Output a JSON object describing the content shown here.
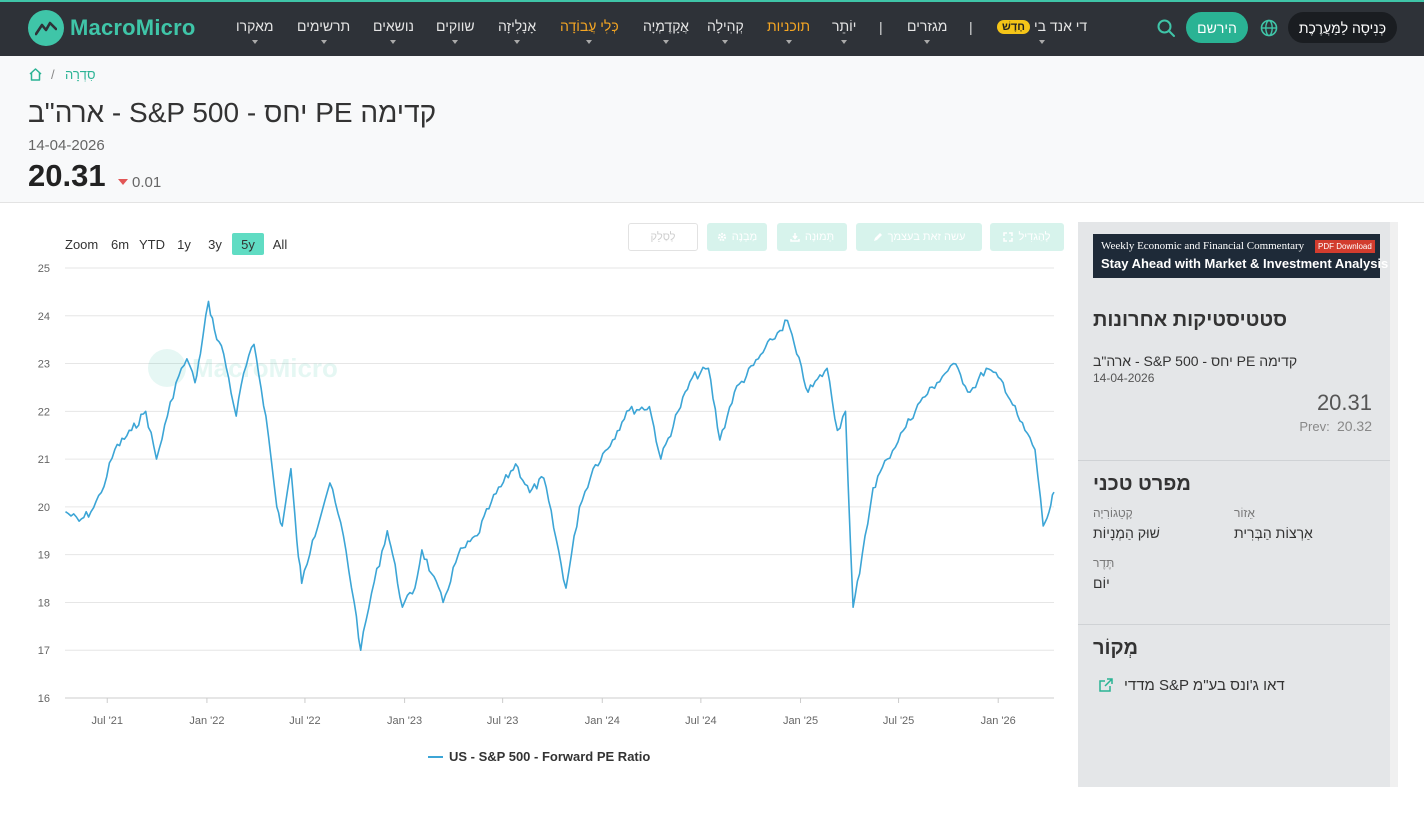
{
  "nav": {
    "logo_text": "MacroMicro",
    "items": [
      "מאקרו",
      "תרשימים",
      "נושאים",
      "שווקים",
      "אָנָלִיזָה",
      "כְּלִי עֲבוֹדָה",
      "אֲקָדֶמְיָה",
      "קְהִילָה",
      "תוכניות",
      "יוֹתֵר",
      "מגזרים",
      "די אנד בי"
    ],
    "separator": "|",
    "new_badge": "חָדָשׁ",
    "register": "הירשם",
    "login": "כְּנִיסָה לַמַּעֲרֶכֶת"
  },
  "breadcrumb": {
    "separator": "/",
    "link": "סִדְרָה"
  },
  "header": {
    "title": "ארה\"ב - S&P 500 - יחס PE קדימה",
    "date": "14-04-2026",
    "value": "20.31",
    "change": "0.01"
  },
  "toolbar": {
    "zoom_label": "Zoom",
    "ranges": [
      "6m",
      "YTD",
      "1y",
      "3y",
      "5y",
      "All"
    ],
    "active_range": "5y",
    "buttons": [
      "לְהַגדִיל",
      "עשה זאת בעצמך",
      "תְּמוּנָה",
      "מַבְנֶה",
      "לְסַלֵק"
    ]
  },
  "chart_data": {
    "type": "line",
    "title": "",
    "xlabel": "",
    "ylabel": "",
    "x_ticks": [
      "Jul '21",
      "Jan '22",
      "Jul '22",
      "Jan '23",
      "Jul '23",
      "Jan '24",
      "Jul '24",
      "Jan '25",
      "Jul '25",
      "Jan '26"
    ],
    "ylim": [
      16,
      25
    ],
    "y_ticks": [
      16,
      17,
      18,
      19,
      20,
      21,
      22,
      23,
      24,
      25
    ],
    "grid": true,
    "legend_position": "bottom-center",
    "watermark": "MacroMicro",
    "series": [
      {
        "name": "US - S&P 500 - Forward PE Ratio",
        "color": "#3ca5d6",
        "points": [
          [
            "2021-04-15",
            19.9
          ],
          [
            "2021-05-10",
            19.7
          ],
          [
            "2021-06-01",
            19.9
          ],
          [
            "2021-06-20",
            20.3
          ],
          [
            "2021-07-15",
            21.2
          ],
          [
            "2021-08-15",
            21.6
          ],
          [
            "2021-09-10",
            22.0
          ],
          [
            "2021-09-30",
            21.0
          ],
          [
            "2021-10-20",
            21.9
          ],
          [
            "2021-11-05",
            22.6
          ],
          [
            "2021-11-25",
            23.1
          ],
          [
            "2021-12-10",
            22.6
          ],
          [
            "2021-12-20",
            23.2
          ],
          [
            "2022-01-04",
            24.3
          ],
          [
            "2022-01-15",
            23.7
          ],
          [
            "2022-02-01",
            23.2
          ],
          [
            "2022-02-24",
            21.9
          ],
          [
            "2022-03-10",
            22.8
          ],
          [
            "2022-03-29",
            23.4
          ],
          [
            "2022-04-20",
            21.9
          ],
          [
            "2022-05-10",
            20.0
          ],
          [
            "2022-05-20",
            19.6
          ],
          [
            "2022-06-05",
            20.8
          ],
          [
            "2022-06-16",
            19.3
          ],
          [
            "2022-06-25",
            18.4
          ],
          [
            "2022-07-15",
            19.3
          ],
          [
            "2022-08-16",
            20.5
          ],
          [
            "2022-09-10",
            19.4
          ],
          [
            "2022-09-30",
            18.0
          ],
          [
            "2022-10-12",
            17.0
          ],
          [
            "2022-11-01",
            18.2
          ],
          [
            "2022-11-30",
            19.5
          ],
          [
            "2022-12-10",
            19.0
          ],
          [
            "2022-12-28",
            17.9
          ],
          [
            "2023-01-20",
            18.3
          ],
          [
            "2023-02-02",
            19.1
          ],
          [
            "2023-02-20",
            18.6
          ],
          [
            "2023-03-13",
            18.0
          ],
          [
            "2023-04-10",
            19.0
          ],
          [
            "2023-05-15",
            19.4
          ],
          [
            "2023-06-10",
            20.1
          ],
          [
            "2023-07-25",
            20.9
          ],
          [
            "2023-08-20",
            20.3
          ],
          [
            "2023-09-15",
            20.6
          ],
          [
            "2023-10-26",
            18.3
          ],
          [
            "2023-11-20",
            20.0
          ],
          [
            "2023-12-15",
            20.8
          ],
          [
            "2024-01-20",
            21.4
          ],
          [
            "2024-02-15",
            22.0
          ],
          [
            "2024-03-28",
            22.1
          ],
          [
            "2024-04-18",
            21.0
          ],
          [
            "2024-05-20",
            22.0
          ],
          [
            "2024-06-15",
            22.7
          ],
          [
            "2024-07-15",
            22.9
          ],
          [
            "2024-08-05",
            21.4
          ],
          [
            "2024-09-01",
            22.4
          ],
          [
            "2024-10-15",
            23.1
          ],
          [
            "2024-11-10",
            23.5
          ],
          [
            "2024-12-08",
            23.9
          ],
          [
            "2024-12-25",
            23.2
          ],
          [
            "2025-01-15",
            22.4
          ],
          [
            "2025-02-19",
            22.9
          ],
          [
            "2025-03-10",
            21.6
          ],
          [
            "2025-03-25",
            22.0
          ],
          [
            "2025-04-08",
            17.9
          ],
          [
            "2025-04-20",
            18.6
          ],
          [
            "2025-05-15",
            20.4
          ],
          [
            "2025-06-10",
            21.0
          ],
          [
            "2025-07-10",
            21.6
          ],
          [
            "2025-08-10",
            22.2
          ],
          [
            "2025-09-10",
            22.6
          ],
          [
            "2025-10-10",
            23.0
          ],
          [
            "2025-11-10",
            22.4
          ],
          [
            "2025-12-10",
            22.9
          ],
          [
            "2026-01-10",
            22.6
          ],
          [
            "2026-02-10",
            21.8
          ],
          [
            "2026-03-10",
            21.2
          ],
          [
            "2026-03-25",
            19.6
          ],
          [
            "2026-04-05",
            19.9
          ],
          [
            "2026-04-14",
            20.31
          ]
        ]
      }
    ]
  },
  "sidebar": {
    "ad": {
      "line1": "Weekly Economic and Financial Commentary",
      "badge": "PDF Download",
      "line2": "Stay Ahead with  Market & Investment Analysis"
    },
    "stats_heading": "סטטיסטיקות אחרונות",
    "stats_series": "ארה\"ב - S&P 500 - יחס PE קדימה",
    "stats_date": "14-04-2026",
    "stats_value": "20.31",
    "prev_label": "Prev:",
    "prev_value": "20.32",
    "tech_heading": "מפרט טכני",
    "region_label": "אֵזוֹר",
    "region_value": "אַרְצוֹת הַבְּרִית",
    "category_label": "קָטֵגוֹרִיָה",
    "category_value": "שׁוּק הַמְנָיוֹת",
    "frequency_label": "תֶּדֶר",
    "frequency_value": "יוֹם",
    "source_heading": "מְקוֹר",
    "source_value": "מדדי S&P דאו ג'ונס בע\"מ"
  }
}
